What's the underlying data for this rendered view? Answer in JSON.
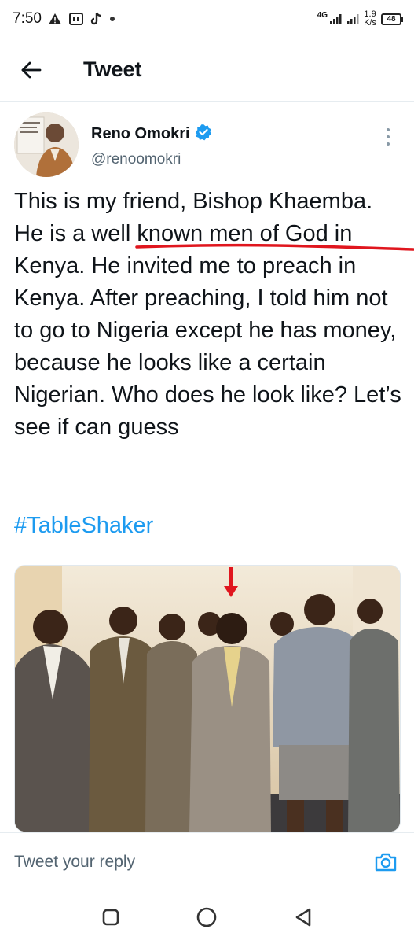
{
  "status_bar": {
    "time": "7:50",
    "network": "4G",
    "speed_value": "1.9",
    "speed_unit": "K/s",
    "battery": "48",
    "icons": [
      "warning-icon",
      "gallery-icon",
      "tiktok-icon",
      "dot-icon",
      "signal-icon",
      "signal-icon",
      "battery-icon"
    ]
  },
  "header": {
    "title": "Tweet",
    "back_icon": "arrow-left-icon"
  },
  "author": {
    "name": "Reno Omokri",
    "handle": "@renoomokri",
    "verified": true,
    "verified_color": "#1d9bf0"
  },
  "tweet": {
    "text": "This is my friend, Bishop Khaemba. He is a well known men of God in Kenya. He invited me to preach in Kenya. After preaching, I told him not to go to Nigeria except he has money, because he looks like a certain Nigerian. Who does he look like? Let’s see if can guess",
    "hashtag": "#TableShaker",
    "hashtag_color": "#1d9bf0",
    "annotation_color": "#e0161e"
  },
  "reply": {
    "placeholder": "Tweet your reply",
    "camera_icon": "camera-icon",
    "accent": "#1d9bf0"
  },
  "nav": {
    "icons": [
      "recents-icon",
      "home-icon",
      "back-icon"
    ]
  }
}
